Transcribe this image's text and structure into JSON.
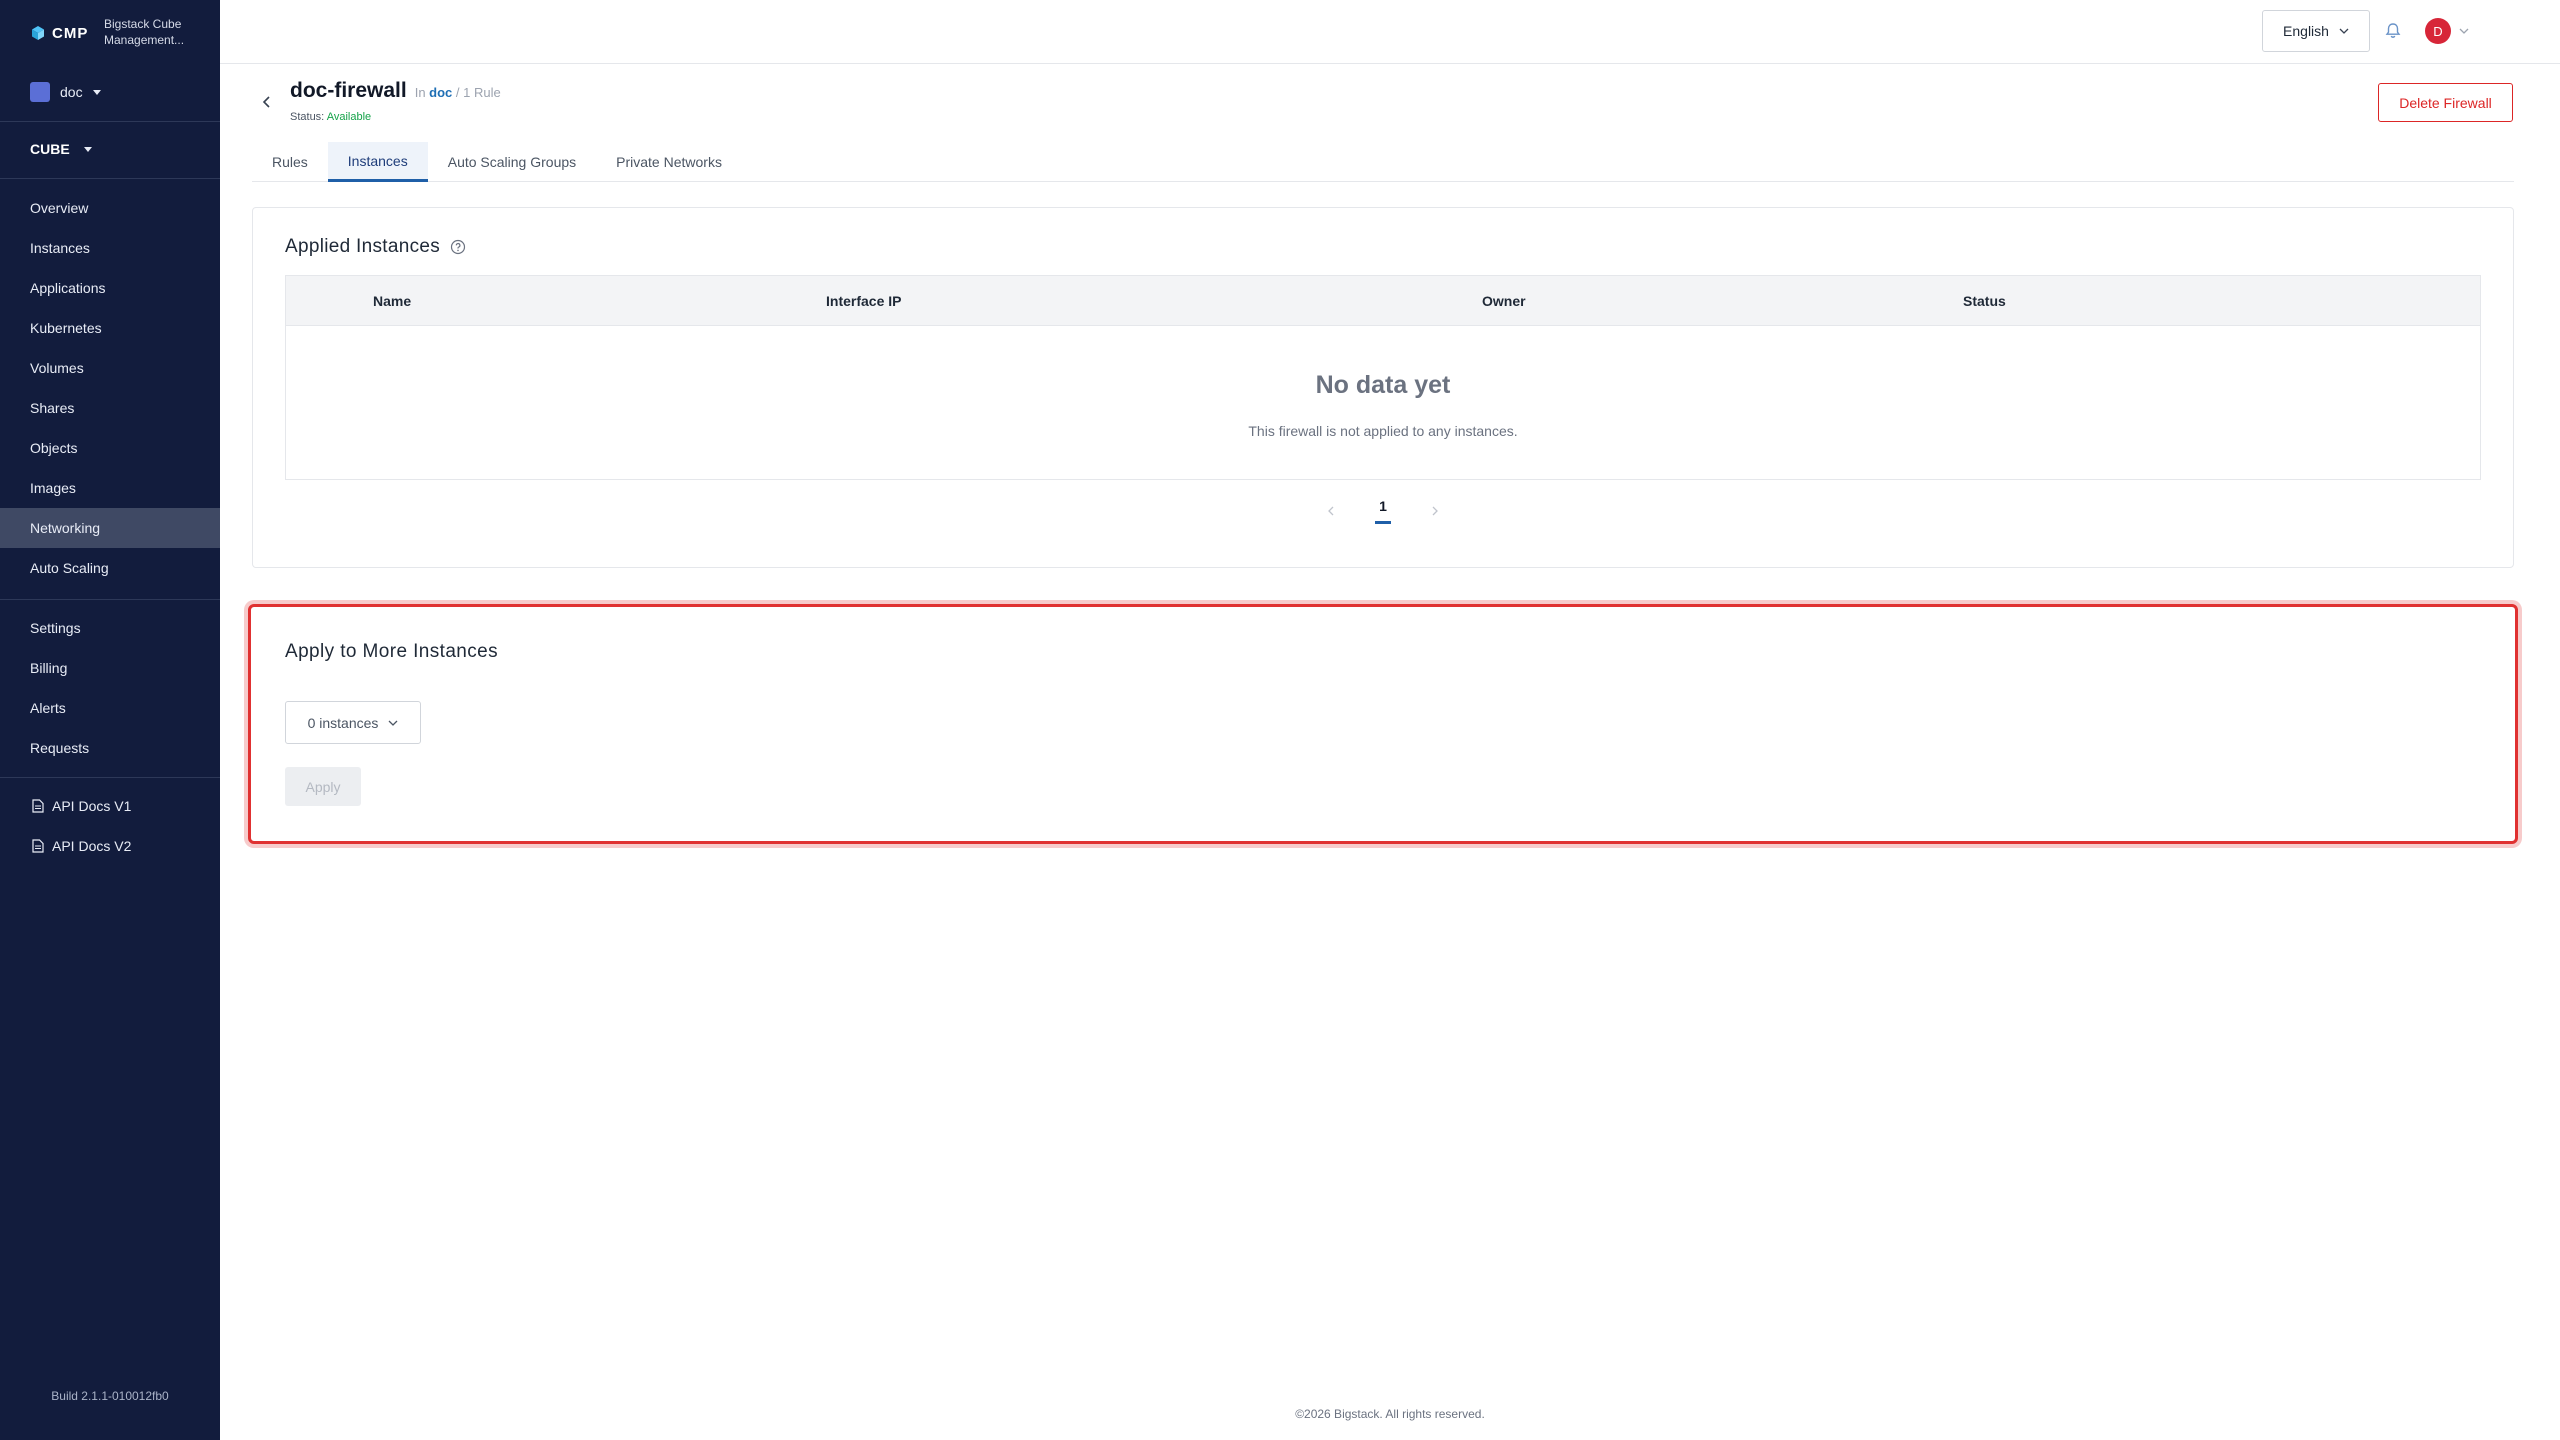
{
  "brand": {
    "logo_text": "CMP",
    "product_name_line1": "Bigstack Cube",
    "product_name_line2": "Management..."
  },
  "sidebar": {
    "project": "doc",
    "service": "CUBE",
    "main_items": [
      {
        "label": "Overview"
      },
      {
        "label": "Instances"
      },
      {
        "label": "Applications"
      },
      {
        "label": "Kubernetes"
      },
      {
        "label": "Volumes"
      },
      {
        "label": "Shares"
      },
      {
        "label": "Objects"
      },
      {
        "label": "Images"
      },
      {
        "label": "Networking",
        "active": true
      },
      {
        "label": "Auto Scaling"
      }
    ],
    "settings_items": [
      {
        "label": "Settings"
      },
      {
        "label": "Billing"
      },
      {
        "label": "Alerts"
      },
      {
        "label": "Requests"
      }
    ],
    "doc_items": [
      {
        "label": "API Docs V1",
        "icon": "document-icon"
      },
      {
        "label": "API Docs V2",
        "icon": "document-icon"
      }
    ],
    "build": "Build 2.1.1-010012fb0"
  },
  "topbar": {
    "language": "English",
    "avatar_initial": "D"
  },
  "header": {
    "title": "doc-firewall",
    "meta_in": "In",
    "meta_project": "doc",
    "meta_rules": "/ 1 Rule",
    "status_label": "Status:",
    "status_value": "Available",
    "delete_label": "Delete Firewall"
  },
  "tabs": [
    {
      "label": "Rules"
    },
    {
      "label": "Instances",
      "active": true
    },
    {
      "label": "Auto Scaling Groups"
    },
    {
      "label": "Private Networks"
    }
  ],
  "applied": {
    "title": "Applied Instances",
    "columns": [
      "Name",
      "Interface IP",
      "Owner",
      "Status"
    ],
    "empty_title": "No data yet",
    "empty_subtitle": "This firewall is not applied to any instances.",
    "current_page": "1"
  },
  "apply_more": {
    "title": "Apply to More Instances",
    "select_value": "0 instances",
    "apply_label": "Apply"
  },
  "footer": "©2026 Bigstack. All rights reserved.",
  "colors": {
    "sidebar_bg": "#121c3d",
    "active_nav": "#3f4964",
    "accent": "#1f5fa8",
    "danger": "#dc2626",
    "status_ok": "#16a34a"
  }
}
